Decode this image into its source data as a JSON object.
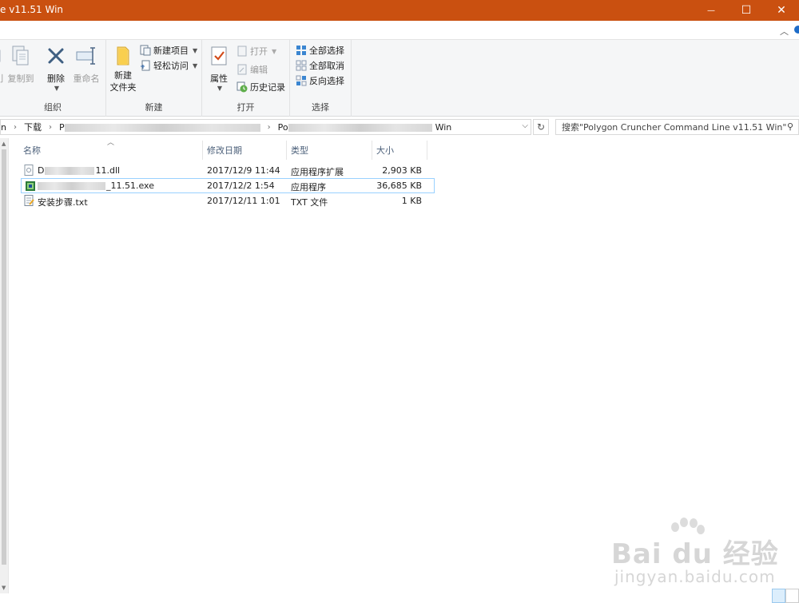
{
  "window": {
    "title": "e v11.51 Win",
    "controls": {
      "minimize": "—",
      "maximize": "☐",
      "close": "✕"
    }
  },
  "ribbon": {
    "groups": [
      {
        "label": "组织",
        "buttons": [
          {
            "label": "刂"
          },
          {
            "label": "复制到"
          },
          {
            "label": "删除"
          },
          {
            "label": "重命名"
          }
        ]
      },
      {
        "label": "新建",
        "buttons": [
          {
            "label": "新建\n文件夹"
          },
          {
            "label": "新建项目"
          },
          {
            "label": "轻松访问"
          }
        ]
      },
      {
        "label": "打开",
        "buttons": [
          {
            "label": "属性"
          },
          {
            "label": "打开"
          },
          {
            "label": "编辑"
          },
          {
            "label": "历史记录"
          }
        ]
      },
      {
        "label": "选择",
        "buttons": [
          {
            "label": "全部选择"
          },
          {
            "label": "全部取消"
          },
          {
            "label": "反向选择"
          }
        ]
      }
    ]
  },
  "address": {
    "segments": [
      "n",
      "下载",
      "P",
      "Po",
      "Win"
    ],
    "search_placeholder": "搜索\"Polygon Cruncher Command Line v11.51 Win\""
  },
  "filelist": {
    "columns": [
      "名称",
      "修改日期",
      "类型",
      "大小"
    ],
    "files": [
      {
        "name_start": "D",
        "name_end": "11.dll",
        "date": "2017/12/9 11:44",
        "type": "应用程序扩展",
        "size": "2,903 KB",
        "icon": "dll-file-icon"
      },
      {
        "name_start": "",
        "name_end": "_11.51.exe",
        "date": "2017/12/2 1:54",
        "type": "应用程序",
        "size": "36,685 KB",
        "icon": "exe-file-icon",
        "selected": true
      },
      {
        "name_start": "安装步骤.txt",
        "name_end": "",
        "date": "2017/12/11 1:01",
        "type": "TXT 文件",
        "size": "1 KB",
        "icon": "text-file-icon"
      }
    ]
  },
  "watermark": {
    "brand": "Bai du 经验",
    "url": "jingyan.baidu.com"
  }
}
